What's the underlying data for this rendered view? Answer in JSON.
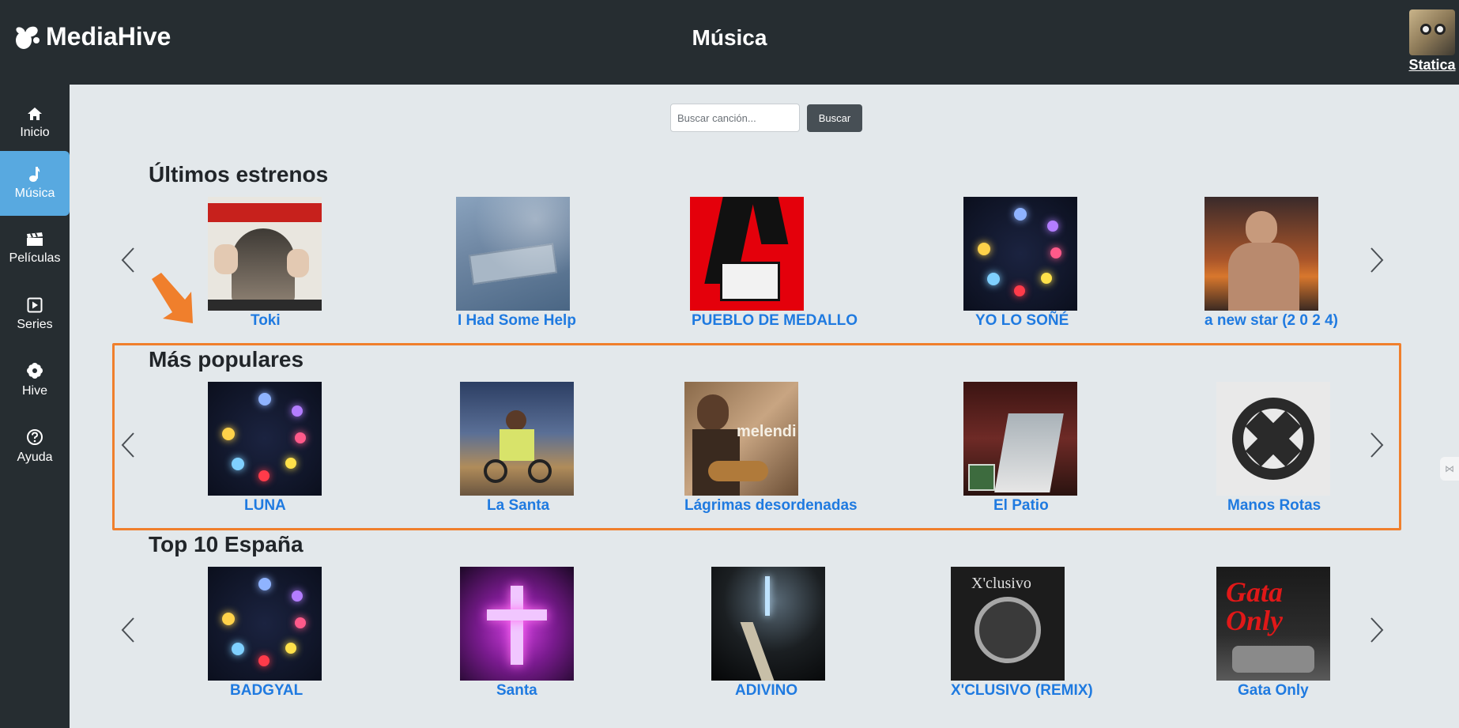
{
  "header": {
    "brand": "MediaHive",
    "page_title": "Música",
    "user_name": "Statica"
  },
  "sidebar": {
    "items": [
      {
        "label": "Inicio",
        "icon": "home-icon"
      },
      {
        "label": "Música",
        "icon": "music-note-icon",
        "active": true
      },
      {
        "label": "Películas",
        "icon": "clapperboard-icon"
      },
      {
        "label": "Series",
        "icon": "play-square-icon"
      },
      {
        "label": "Hive",
        "icon": "flower-icon"
      },
      {
        "label": "Ayuda",
        "icon": "help-circle-icon"
      }
    ]
  },
  "search": {
    "placeholder": "Buscar canción...",
    "button_label": "Buscar"
  },
  "sections": [
    {
      "title": "Últimos estrenos",
      "items": [
        {
          "title": "Toki",
          "art": "toki-cover"
        },
        {
          "title": "I Had Some Help",
          "art": "i-had-some-help-cover"
        },
        {
          "title": "PUEBLO DE MEDALLO",
          "art": "pueblo-de-medallo-cover"
        },
        {
          "title": "YO LO SOÑÉ",
          "art": "yo-lo-sone-cover"
        },
        {
          "title": "a new star (2 0 2 4)",
          "art": "a-new-star-cover"
        }
      ]
    },
    {
      "title": "Más populares",
      "items": [
        {
          "title": "LUNA",
          "art": "luna-cover"
        },
        {
          "title": "La Santa",
          "art": "la-santa-cover"
        },
        {
          "title": "Lágrimas desordenadas",
          "art": "lagrimas-desordenadas-cover"
        },
        {
          "title": "El Patio",
          "art": "el-patio-cover"
        },
        {
          "title": "Manos Rotas",
          "art": "manos-rotas-cover"
        }
      ]
    },
    {
      "title": "Top 10 España",
      "items": [
        {
          "title": "BADGYAL",
          "art": "badgyal-cover"
        },
        {
          "title": "Santa",
          "art": "santa-cover"
        },
        {
          "title": "ADIVINO",
          "art": "adivino-cover"
        },
        {
          "title": "X'CLUSIVO (REMIX)",
          "art": "xclusivo-remix-cover"
        },
        {
          "title": "Gata Only",
          "art": "gata-only-cover"
        }
      ]
    }
  ],
  "colors": {
    "topbar": "#262d31",
    "sidebar_active": "#58a9e0",
    "link": "#1f7ae0",
    "highlight_annotation": "#f07f2c",
    "background": "#e3e8eb"
  }
}
